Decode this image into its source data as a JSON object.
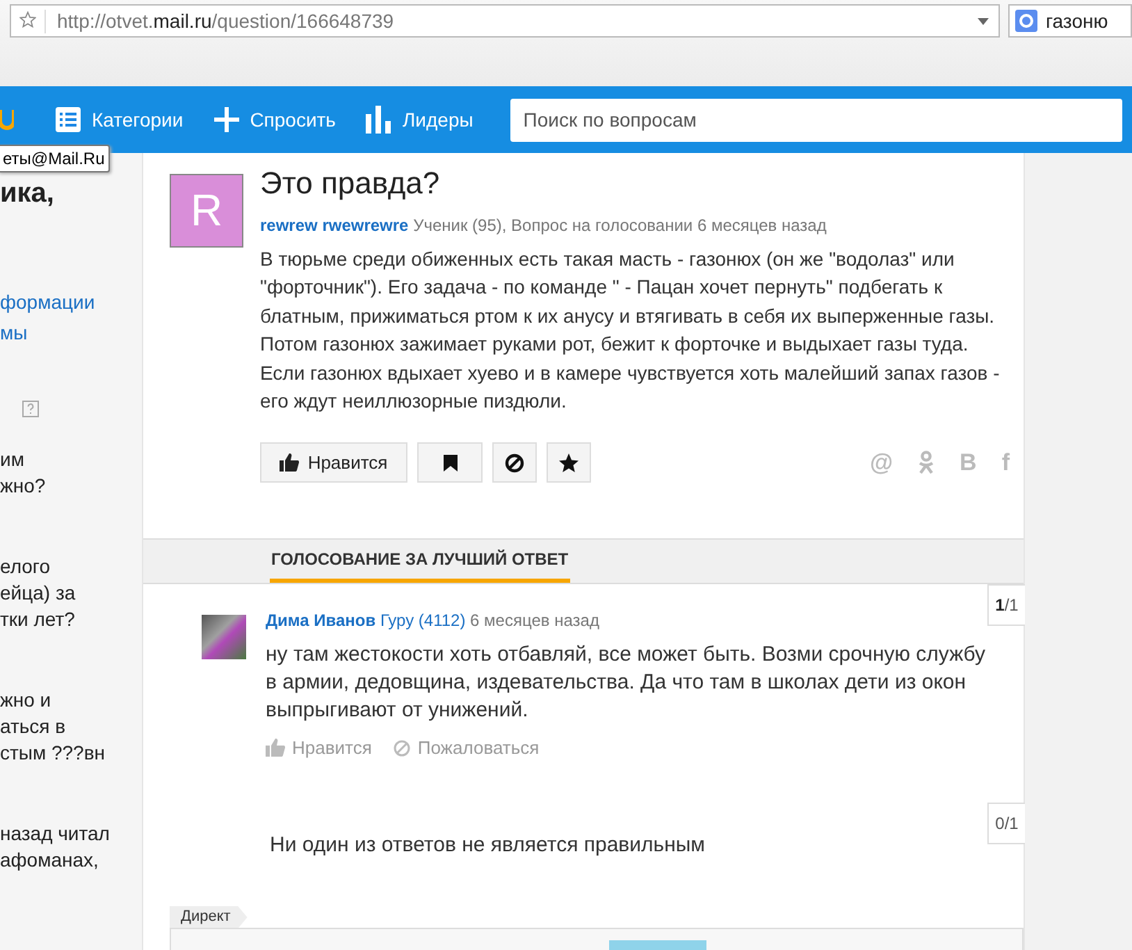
{
  "browser": {
    "url_prefix": "http://otvet.",
    "url_domain": "mail.ru",
    "url_path": "/question/166648739",
    "search_text": "газоню"
  },
  "nav": {
    "items": [
      {
        "kind": "list",
        "label": "Категории"
      },
      {
        "kind": "plus",
        "label": "Спросить"
      },
      {
        "kind": "bars",
        "label": "Лидеры"
      }
    ],
    "search": {
      "placeholder": "Поиск по вопросам"
    }
  },
  "tooltip": "еты@Mail.Ru",
  "left_column": [
    {
      "kind": "heading",
      "text": "ика,"
    },
    {
      "kind": "link",
      "text": "формации"
    },
    {
      "kind": "link",
      "text": "мы"
    },
    {
      "kind": "help"
    },
    {
      "kind": "text",
      "lines": [
        "им",
        "жно?"
      ]
    },
    {
      "kind": "text",
      "lines": [
        "елого",
        "ейца) за",
        "тки лет?"
      ]
    },
    {
      "kind": "text",
      "lines": [
        "жно и",
        "аться в",
        "стым ???вн"
      ]
    },
    {
      "kind": "text",
      "lines": [
        "назад читал",
        "афоманах,"
      ]
    }
  ],
  "question": {
    "avatar_letter": "R",
    "title": "Это правда?",
    "author": "rewrew rwewrewre",
    "meta": "Ученик (95), Вопрос на голосовании 6 месяцев назад",
    "body": "В тюрьме среди обиженных есть такая масть - газонюх (он же \"водолаз\" или \"форточник\"). Его задача - по команде \" - Пацан хочет пернуть\" подбегать к блатным, прижиматься ртом к их анусу и втягивать в себя их выперженные газы. Потом газонюх зажимает руками рот, бежит к форточке и выдыхает газы туда. Если газонюх вдыхает хуево и в камере чувствуется хоть малейший запах газов - его ждут неиллюзорные пиздюли.",
    "actions": [
      {
        "kind": "like",
        "label": "Нравится"
      },
      {
        "kind": "bookmark"
      },
      {
        "kind": "block"
      },
      {
        "kind": "star"
      }
    ],
    "share": [
      {
        "kind": "mail",
        "text": "@"
      },
      {
        "kind": "ok"
      },
      {
        "kind": "vk",
        "text": "В"
      },
      {
        "kind": "fb",
        "text": "f"
      }
    ]
  },
  "section_tab": "ГОЛОСОВАНИЕ ЗА ЛУЧШИЙ ОТВЕТ",
  "answers": [
    {
      "counter_current": "1",
      "counter_total": "/1",
      "author": "Дима Иванов",
      "rank": "Гуру (4112)",
      "time": "6 месяцев назад",
      "text": "ну там жестокости хоть отбавляй, все может быть. Возми срочную службу в армии, дедовщина, издевательства. Да что там в школах дети из окон выпрыгивают от унижений.",
      "like": "Нравится",
      "report": "Пожаловаться"
    }
  ],
  "none_option": {
    "counter": "0/1",
    "text": "Ни один из ответов не является правильным"
  },
  "ad": {
    "tag": "Директ"
  }
}
